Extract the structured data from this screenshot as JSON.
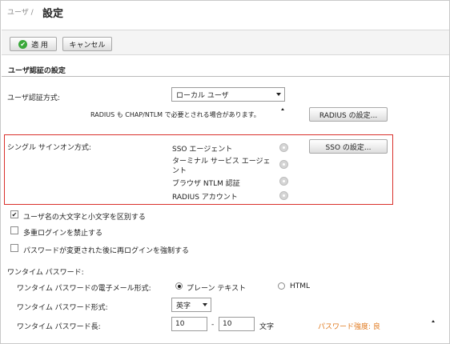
{
  "header": {
    "breadcrumb": "ユーザ /",
    "title": "設定"
  },
  "toolbar": {
    "apply_label": "適 用",
    "cancel_label": "キャンセル"
  },
  "auth": {
    "section_title": "ユーザ認証の設定",
    "method_label": "ユーザ認証方式:",
    "method_value": "ローカル ユーザ",
    "radius_note": "RADIUS も CHAP/NTLM で必要とされる場合があります。",
    "radius_button": "RADIUS の設定..."
  },
  "sso": {
    "label": "シングル サインオン方式:",
    "button": "SSO の設定...",
    "methods": [
      "SSO エージェント",
      "ターミナル サービス エージェ",
      "ント",
      "ブラウザ NTLM 認証",
      "RADIUS アカウント"
    ]
  },
  "options": {
    "case_sensitive": {
      "label": "ユーザ名の大文字と小文字を区別する",
      "checked": true
    },
    "no_multi_login": {
      "label": "多重ログインを禁止する",
      "checked": false
    },
    "force_relogin": {
      "label": "パスワードが変更された後に再ログインを強制する",
      "checked": false
    }
  },
  "otp": {
    "section_label": "ワンタイム パスワード:",
    "email_format_label": "ワンタイム パスワードの電子メール形式:",
    "plain_text_label": "プレーン テキスト",
    "html_label": "HTML",
    "selected_format": "plain",
    "format_label": "ワンタイム パスワード形式:",
    "format_value": "英字",
    "length_label": "ワンタイム パスワード長:",
    "length_min": "10",
    "length_dash": "-",
    "length_max": "10",
    "length_unit": "文字",
    "strength_text": "パスワード強度: 良"
  },
  "colors": {
    "highlight_border": "#d9302b",
    "strength": "#e07a1f",
    "apply_icon": "#3aa83a"
  }
}
